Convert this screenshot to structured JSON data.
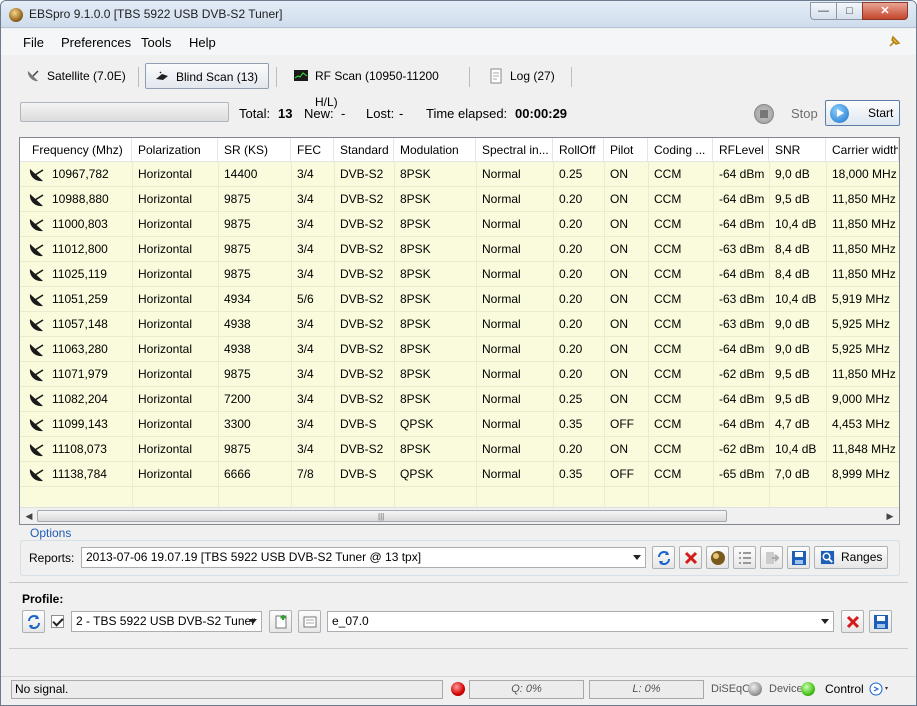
{
  "window": {
    "title": "EBSpro 9.1.0.0 [TBS 5922 USB DVB-S2 Tuner]"
  },
  "menu": {
    "file": "File",
    "preferences": "Preferences",
    "tools": "Tools",
    "help": "Help"
  },
  "tabs": [
    {
      "label": "Satellite (7.0E)",
      "icon": "satellite-icon"
    },
    {
      "label": "Blind Scan (13)",
      "icon": "blind-scan-icon",
      "selected": true
    },
    {
      "label": "RF Scan (10950-11200 H/L)",
      "icon": "rf-scan-icon"
    },
    {
      "label": "Log (27)",
      "icon": "log-icon"
    }
  ],
  "scan": {
    "progress": 0,
    "total_label": "Total:",
    "total": "13",
    "new_label": "New:",
    "new": "-",
    "lost_label": "Lost:",
    "lost": "-",
    "elapsed_label": "Time elapsed:",
    "elapsed": "00:00:29",
    "stop_label": "Stop",
    "start_label": "Start"
  },
  "table": {
    "columns": [
      "Frequency (Mhz)",
      "Polarization",
      "SR (KS)",
      "FEC",
      "Standard",
      "Modulation",
      "Spectral in...",
      "RollOff",
      "Pilot",
      "Coding ...",
      "RFLevel",
      "SNR",
      "Carrier width"
    ],
    "rows": [
      [
        "10967,782",
        "Horizontal",
        "14400",
        "3/4",
        "DVB-S2",
        "8PSK",
        "Normal",
        "0.25",
        "ON",
        "CCM",
        "-64 dBm",
        "9,0 dB",
        "18,000 MHz"
      ],
      [
        "10988,880",
        "Horizontal",
        "9875",
        "3/4",
        "DVB-S2",
        "8PSK",
        "Normal",
        "0.20",
        "ON",
        "CCM",
        "-64 dBm",
        "9,5 dB",
        "11,850 MHz"
      ],
      [
        "11000,803",
        "Horizontal",
        "9875",
        "3/4",
        "DVB-S2",
        "8PSK",
        "Normal",
        "0.20",
        "ON",
        "CCM",
        "-64 dBm",
        "10,4 dB",
        "11,850 MHz"
      ],
      [
        "11012,800",
        "Horizontal",
        "9875",
        "3/4",
        "DVB-S2",
        "8PSK",
        "Normal",
        "0.20",
        "ON",
        "CCM",
        "-63 dBm",
        "8,4 dB",
        "11,850 MHz"
      ],
      [
        "11025,119",
        "Horizontal",
        "9875",
        "3/4",
        "DVB-S2",
        "8PSK",
        "Normal",
        "0.20",
        "ON",
        "CCM",
        "-64 dBm",
        "8,4 dB",
        "11,850 MHz"
      ],
      [
        "11051,259",
        "Horizontal",
        "4934",
        "5/6",
        "DVB-S2",
        "8PSK",
        "Normal",
        "0.20",
        "ON",
        "CCM",
        "-63 dBm",
        "10,4 dB",
        "5,919 MHz"
      ],
      [
        "11057,148",
        "Horizontal",
        "4938",
        "3/4",
        "DVB-S2",
        "8PSK",
        "Normal",
        "0.20",
        "ON",
        "CCM",
        "-63 dBm",
        "9,0 dB",
        "5,925 MHz"
      ],
      [
        "11063,280",
        "Horizontal",
        "4938",
        "3/4",
        "DVB-S2",
        "8PSK",
        "Normal",
        "0.20",
        "ON",
        "CCM",
        "-64 dBm",
        "9,0 dB",
        "5,925 MHz"
      ],
      [
        "11071,979",
        "Horizontal",
        "9875",
        "3/4",
        "DVB-S2",
        "8PSK",
        "Normal",
        "0.20",
        "ON",
        "CCM",
        "-62 dBm",
        "9,5 dB",
        "11,850 MHz"
      ],
      [
        "11082,204",
        "Horizontal",
        "7200",
        "3/4",
        "DVB-S2",
        "8PSK",
        "Normal",
        "0.25",
        "ON",
        "CCM",
        "-64 dBm",
        "9,5 dB",
        "9,000 MHz"
      ],
      [
        "11099,143",
        "Horizontal",
        "3300",
        "3/4",
        "DVB-S",
        "QPSK",
        "Normal",
        "0.35",
        "OFF",
        "CCM",
        "-64 dBm",
        "4,7 dB",
        "4,453 MHz"
      ],
      [
        "11108,073",
        "Horizontal",
        "9875",
        "3/4",
        "DVB-S2",
        "8PSK",
        "Normal",
        "0.20",
        "ON",
        "CCM",
        "-62 dBm",
        "10,4 dB",
        "11,848 MHz"
      ],
      [
        "11138,784",
        "Horizontal",
        "6666",
        "7/8",
        "DVB-S",
        "QPSK",
        "Normal",
        "0.35",
        "OFF",
        "CCM",
        "-65 dBm",
        "7,0 dB",
        "8,999 MHz"
      ]
    ]
  },
  "options": {
    "legend": "Options",
    "reports_label": "Reports:",
    "report_selected": "2013-07-06 19.07.19 [TBS 5922 USB DVB-S2 Tuner @ 13 tpx]",
    "ranges_label": "Ranges"
  },
  "profile": {
    "label": "Profile:",
    "checked": true,
    "tuner_selected": "2 - TBS 5922 USB DVB-S2 Tuner",
    "profile_selected": "e_07.0"
  },
  "status": {
    "signal": "No signal.",
    "q": "Q: 0%",
    "l": "L: 0%",
    "diseqc": "DiSEqC",
    "device": "Device",
    "control": "Control"
  },
  "colors": {
    "row_bg": "#fafadc",
    "accent": "#1e5db3",
    "delete_red": "#d41a1a"
  }
}
